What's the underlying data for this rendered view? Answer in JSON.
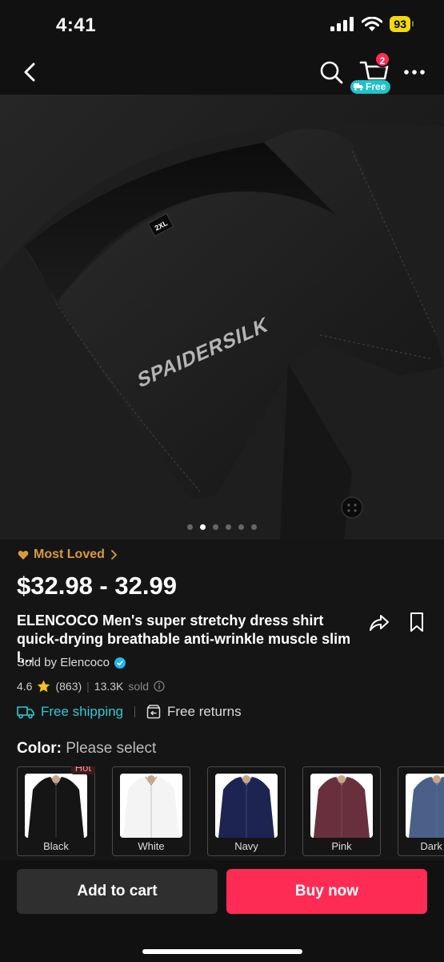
{
  "status_bar": {
    "time": "4:41",
    "battery": "93"
  },
  "nav": {
    "cart_count": "2",
    "free_label": "Free"
  },
  "product": {
    "image_brand_text": "SPAIDERSILK",
    "image_size_tag": "2XL",
    "carousel": {
      "count": 6,
      "active_index": 1
    },
    "badge": "Most Loved",
    "price": "$32.98 - 32.99",
    "title": "ELENCOCO Men's super  stretchy dress shirt quick-drying breathable anti-wrinkle muscle slim l...",
    "seller": "Sold by Elencoco",
    "rating": "4.6",
    "review_count": "(863)",
    "sold": "13.3K",
    "sold_label": "sold",
    "shipping": "Free shipping",
    "returns": "Free returns",
    "color_label": "Color:",
    "color_placeholder": "Please select",
    "colors": [
      {
        "name": "Black",
        "hot": "Hot",
        "shirt": "#151515"
      },
      {
        "name": "White",
        "shirt": "#f4f4f4"
      },
      {
        "name": "Navy",
        "shirt": "#1d2452"
      },
      {
        "name": "Pink",
        "shirt": "#6a2f3c"
      },
      {
        "name": "Dark G",
        "shirt": "#4a6088"
      }
    ]
  },
  "actions": {
    "add_to_cart": "Add to cart",
    "buy_now": "Buy now"
  },
  "colors": {
    "accent": "#fe2c55",
    "teal": "#2fc9cf",
    "gold": "#d99a3a",
    "verified": "#20b8e8"
  }
}
